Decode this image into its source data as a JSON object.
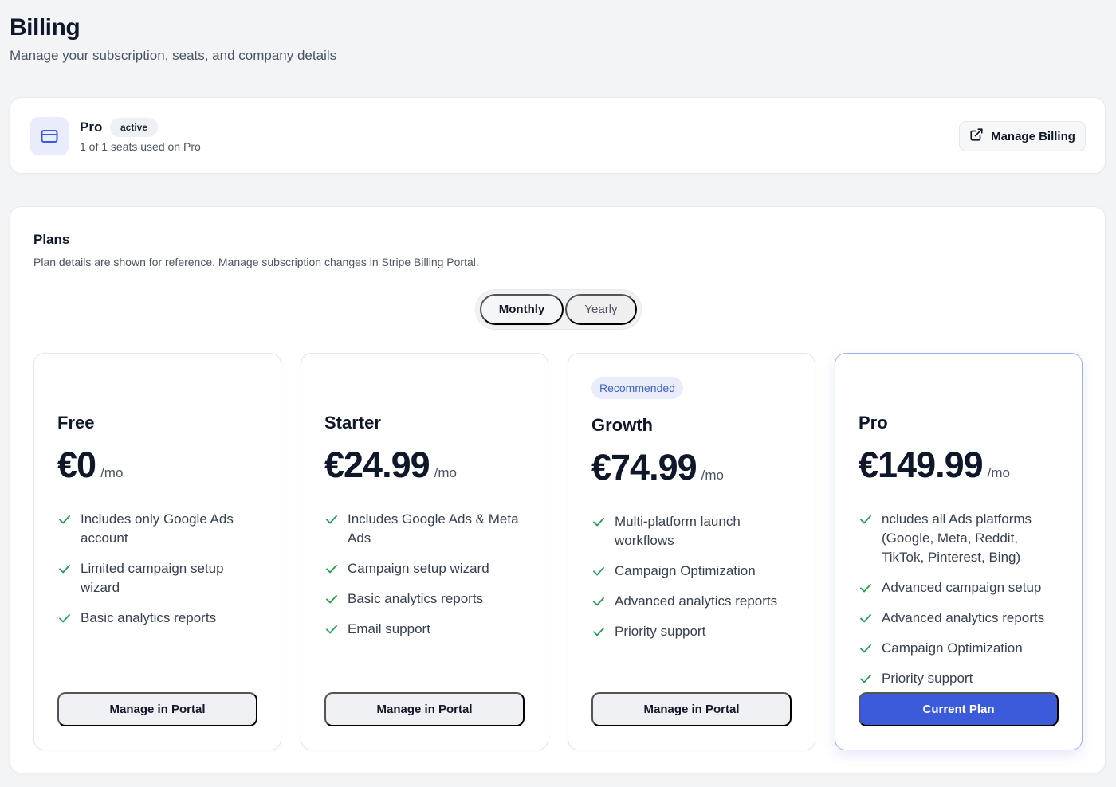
{
  "header": {
    "title": "Billing",
    "subtitle": "Manage your subscription, seats, and company details"
  },
  "subscription": {
    "plan_name": "Pro",
    "status": "active",
    "seats_text": "1 of 1 seats used on Pro",
    "manage_label": "Manage Billing"
  },
  "plans_section": {
    "title": "Plans",
    "description": "Plan details are shown for reference. Manage subscription changes in Stripe Billing Portal.",
    "toggle": {
      "monthly": "Monthly",
      "yearly": "Yearly",
      "selected": "Monthly"
    }
  },
  "plans": [
    {
      "name": "Free",
      "price": "€0",
      "period": "/mo",
      "features": [
        "Includes only Google Ads account",
        "Limited campaign setup wizard",
        "Basic analytics reports"
      ],
      "button": "Manage in Portal"
    },
    {
      "name": "Starter",
      "price": "€24.99",
      "period": "/mo",
      "features": [
        "Includes Google Ads & Meta Ads",
        "Campaign setup wizard",
        "Basic analytics reports",
        "Email support"
      ],
      "button": "Manage in Portal"
    },
    {
      "name": "Growth",
      "badge": "Recommended",
      "price": "€74.99",
      "period": "/mo",
      "features": [
        "Multi-platform launch workflows",
        "Campaign Optimization",
        "Advanced analytics reports",
        "Priority support"
      ],
      "button": "Manage in Portal"
    },
    {
      "name": "Pro",
      "price": "€149.99",
      "period": "/mo",
      "features": [
        "ncludes all Ads platforms (Google, Meta, Reddit, TikTok, Pinterest, Bing)",
        "Advanced campaign setup",
        "Advanced analytics reports",
        "Campaign Optimization",
        "Priority support"
      ],
      "button": "Current Plan"
    }
  ],
  "colors": {
    "accent": "#3b5bdb",
    "check": "#22a355",
    "badge_bg": "#e8ecfb",
    "page_bg": "#f3f4f6"
  },
  "icons": {
    "subscription": "credit-card-icon",
    "manage_billing": "external-link-icon",
    "feature": "check-icon"
  }
}
